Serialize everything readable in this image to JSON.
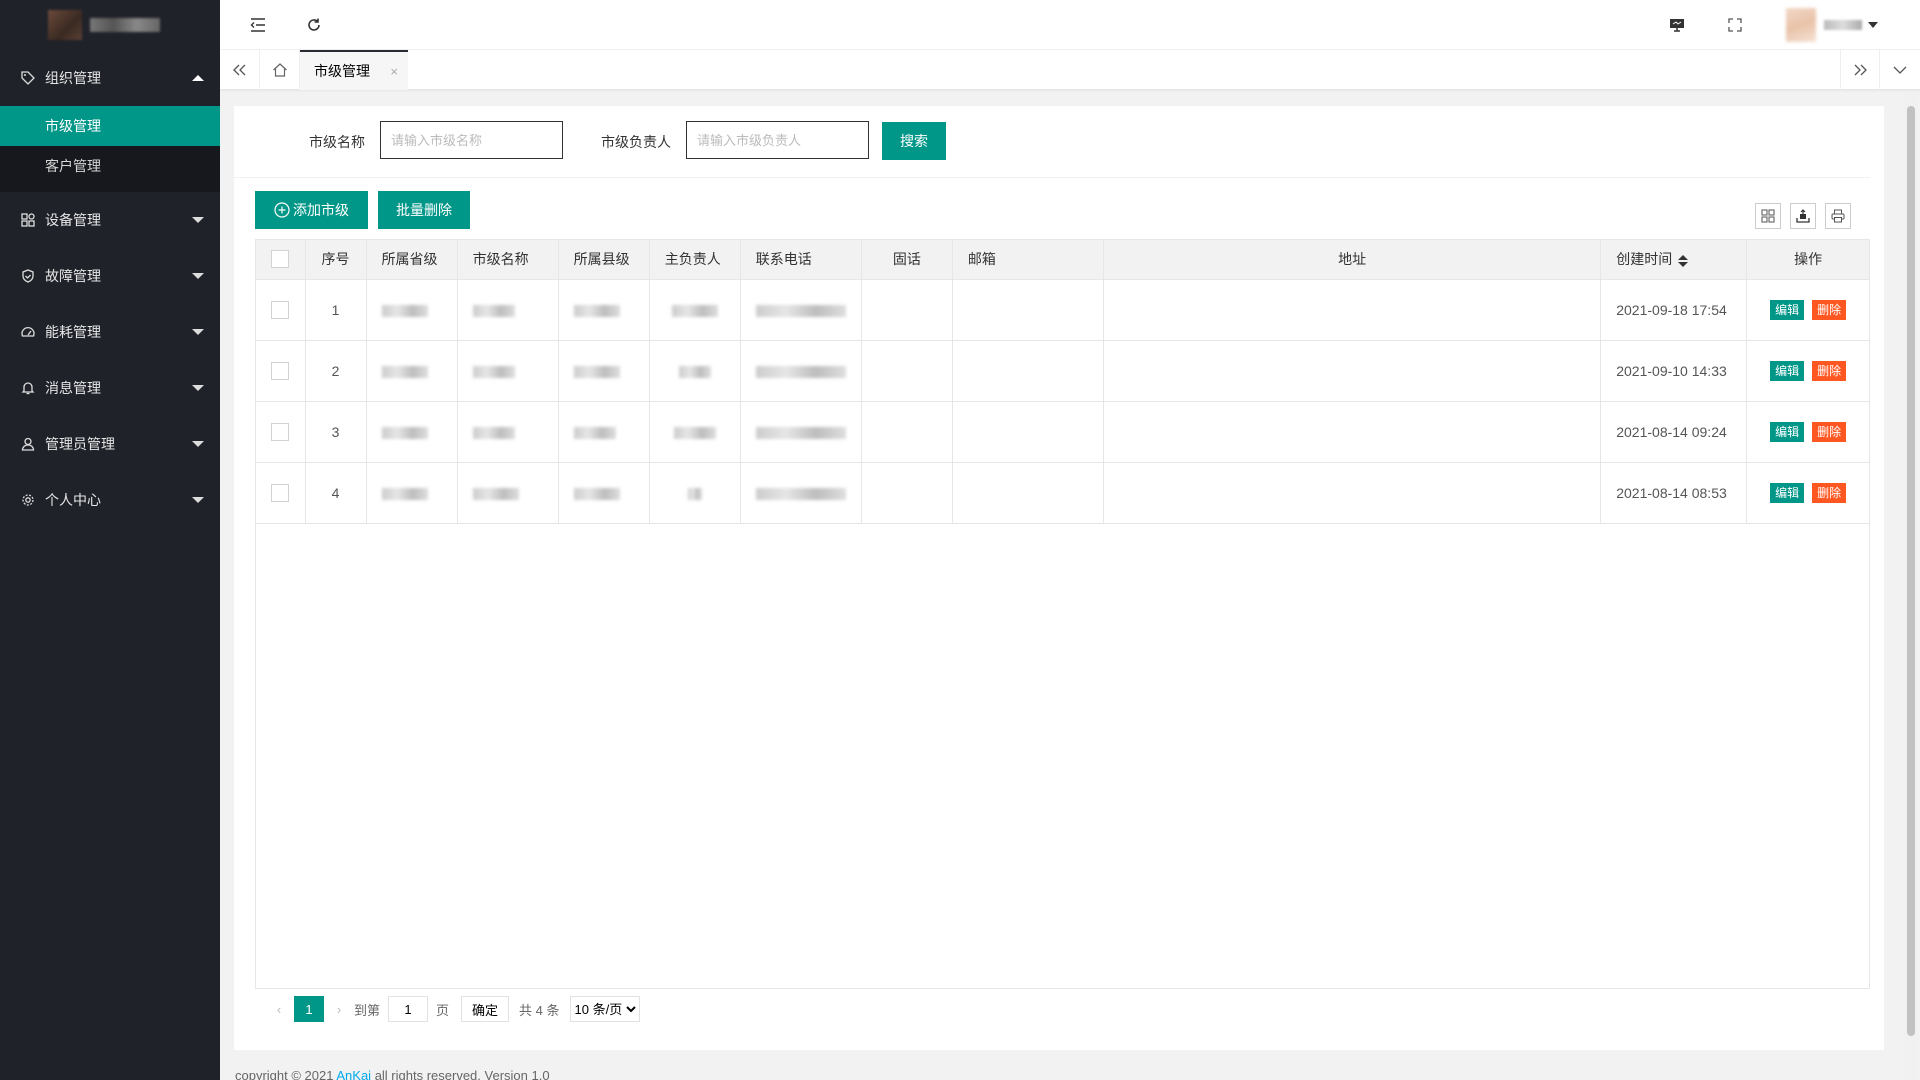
{
  "sidebar": {
    "groups": [
      {
        "label": "组织管理",
        "icon": "tag-icon",
        "open": true,
        "children": [
          {
            "label": "市级管理",
            "active": true
          },
          {
            "label": "客户管理",
            "active": false
          }
        ]
      },
      {
        "label": "设备管理",
        "icon": "device-icon"
      },
      {
        "label": "故障管理",
        "icon": "shield-icon"
      },
      {
        "label": "能耗管理",
        "icon": "gauge-icon"
      },
      {
        "label": "消息管理",
        "icon": "bell-icon"
      },
      {
        "label": "管理员管理",
        "icon": "user-icon"
      },
      {
        "label": "个人中心",
        "icon": "gear-icon"
      }
    ]
  },
  "tabs": {
    "active": "市级管理",
    "close": "×"
  },
  "search": {
    "name_label": "市级名称",
    "name_placeholder": "请输入市级名称",
    "owner_label": "市级负责人",
    "owner_placeholder": "请输入市级负责人",
    "search_button": "搜索"
  },
  "toolbar": {
    "add_button": "添加市级",
    "batch_delete_button": "批量删除"
  },
  "table": {
    "headers": [
      "序号",
      "所属省级",
      "市级名称",
      "所属县级",
      "主负责人",
      "联系电话",
      "固话",
      "邮箱",
      "地址",
      "创建时间",
      "操作"
    ],
    "rows": [
      {
        "index": "1",
        "created": "2021-09-18 17:54"
      },
      {
        "index": "2",
        "created": "2021-09-10 14:33"
      },
      {
        "index": "3",
        "created": "2021-08-14 09:24"
      },
      {
        "index": "4",
        "created": "2021-08-14 08:53"
      }
    ],
    "edit_label": "编辑",
    "delete_label": "删除"
  },
  "pager": {
    "current": "1",
    "goto_label": "到第",
    "goto_value": "1",
    "page_unit": "页",
    "confirm": "确定",
    "total": "共 4 条",
    "page_size": "10 条/页"
  },
  "footer": {
    "prefix": "copyright © 2021 ",
    "brand": "AnKai",
    "suffix": " all rights reserved. Version 1.0"
  }
}
